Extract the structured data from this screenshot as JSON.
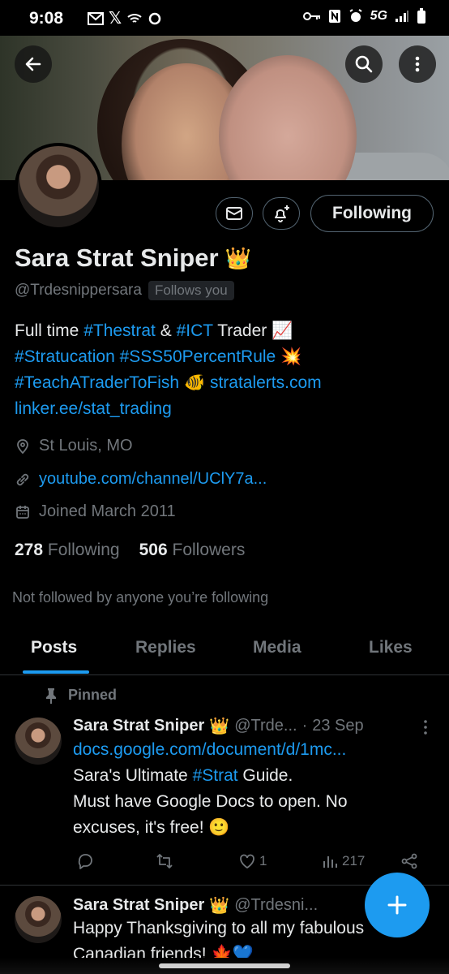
{
  "status": {
    "time": "9:08",
    "left_icons": [
      "mail-icon",
      "x-logo-icon",
      "wifi-icon",
      "sync-icon"
    ],
    "network": "5G",
    "right_icons": [
      "key-icon",
      "nfc-icon",
      "alarm-icon",
      "signal-icon",
      "battery-icon"
    ]
  },
  "header": {
    "back_icon": "arrow-left-icon",
    "search_icon": "search-icon",
    "more_icon": "more-vertical-icon"
  },
  "profile": {
    "name": "Sara Strat Sniper",
    "name_emoji": "👑",
    "handle": "@Trdesnippersara",
    "follows_you": "Follows you",
    "following_button": "Following",
    "bio": {
      "line1_a": "Full time ",
      "line1_tag1": "#Thestrat",
      "line1_b": " & ",
      "line1_tag2": "#ICT",
      "line1_c": " Trader ",
      "line1_emoji": "📈",
      "line2_tag1": "#Stratucation",
      "line2_tag2": "#SSS50PercentRule",
      "line2_emoji": "💥",
      "line3_tag": "#TeachATraderToFish",
      "line3_emoji": "🐠",
      "line3_link": "stratalerts.com",
      "line4_link": "linker.ee/stat_trading"
    },
    "location": "St Louis, MO",
    "website": "youtube.com/channel/UClY7a...",
    "joined": "Joined March 2011",
    "following_count": "278",
    "following_label": "Following",
    "followers_count": "506",
    "followers_label": "Followers",
    "not_followed": "Not followed by anyone you’re following"
  },
  "tabs": [
    "Posts",
    "Replies",
    "Media",
    "Likes"
  ],
  "active_tab": "Posts",
  "pinned_label": "Pinned",
  "tweets": [
    {
      "name": "Sara Strat Sniper",
      "emoji": "👑",
      "handle": "@Trde...",
      "dot": "·",
      "date": "23 Sep",
      "link": "docs.google.com/document/d/1mc...",
      "text_a": "Sara's Ultimate ",
      "text_tag": "#Strat",
      "text_b": " Guide.",
      "text_line2": "Must have Google Docs to open. No",
      "text_line3": "excuses, it's free! 🙂",
      "likes": "1",
      "views": "217"
    },
    {
      "name": "Sara Strat Sniper",
      "emoji": "👑",
      "handle": "@Trdesni...",
      "text_line1": "Happy Thanksgiving to all my fabulous",
      "text_line2": "Canadian friends! 🍁💙"
    }
  ],
  "colors": {
    "accent": "#1d9bf0",
    "background": "#000000",
    "text_primary": "#e7e9ea",
    "text_secondary": "#71767b"
  }
}
